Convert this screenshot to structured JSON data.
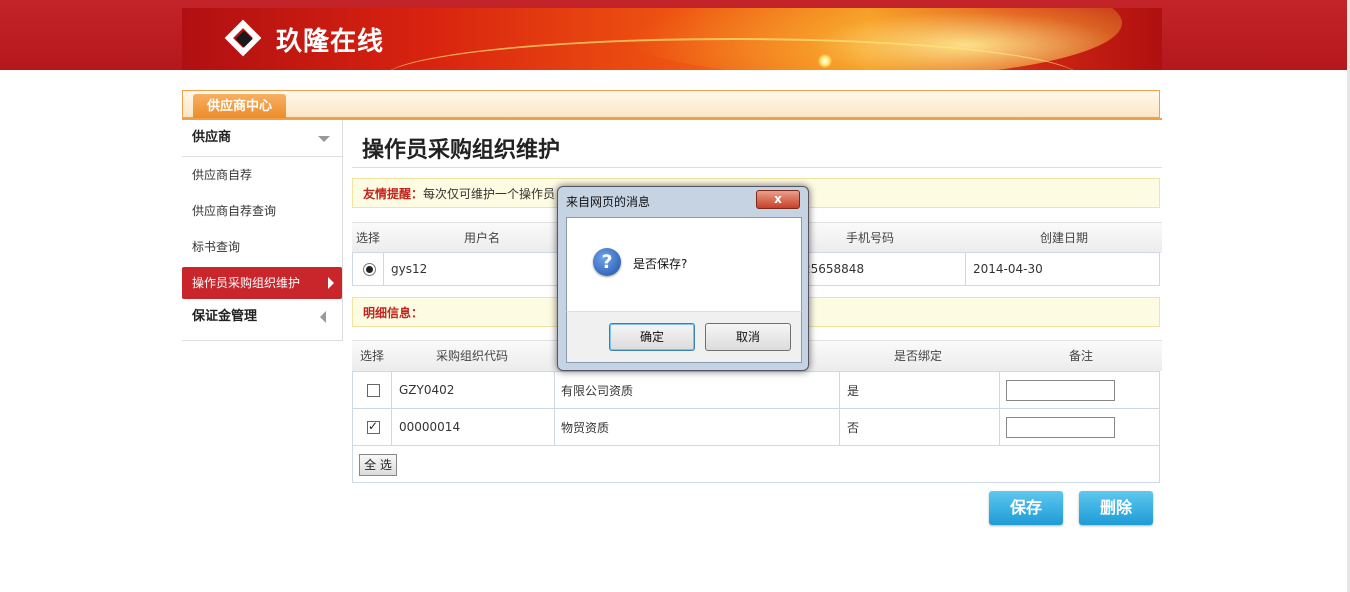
{
  "header": {
    "brand": "玖隆在线"
  },
  "center": {
    "tab": "供应商中心"
  },
  "sidebar": {
    "group1": "供应商",
    "items": [
      "供应商自荐",
      "供应商自荐查询",
      "标书查询",
      "操作员采购组织维护"
    ],
    "group2": "保证金管理"
  },
  "main": {
    "title": "操作员采购组织维护",
    "notice": {
      "label": "友情提醒：",
      "text": "每次仅可维护一个操作员"
    },
    "operator_grid": {
      "headers": [
        "选择",
        "用户名",
        "手机号码",
        "创建日期"
      ],
      "row": {
        "username": "gys12",
        "phone": "25658848",
        "created": "2014-04-30"
      }
    },
    "detail": {
      "label": "明细信息："
    },
    "detail_grid": {
      "headers": [
        "选择",
        "采购组织代码",
        "是否绑定",
        "备注"
      ],
      "rows": [
        {
          "code": "GZY0402",
          "name": "有限公司资质",
          "bound": "是",
          "checked": false
        },
        {
          "code": "00000014",
          "name": "物贸资质",
          "bound": "否",
          "checked": true
        }
      ]
    },
    "select_all": "全 选",
    "save": "保存",
    "delete": "删除"
  },
  "dialog": {
    "title": "来自网页的消息",
    "message": "是否保存?",
    "ok": "确定",
    "cancel": "取消",
    "close": "x"
  },
  "colors": {
    "brand_red": "#c9262c",
    "accent_orange": "#ec8b29",
    "button_blue": "#1e9bd6"
  }
}
